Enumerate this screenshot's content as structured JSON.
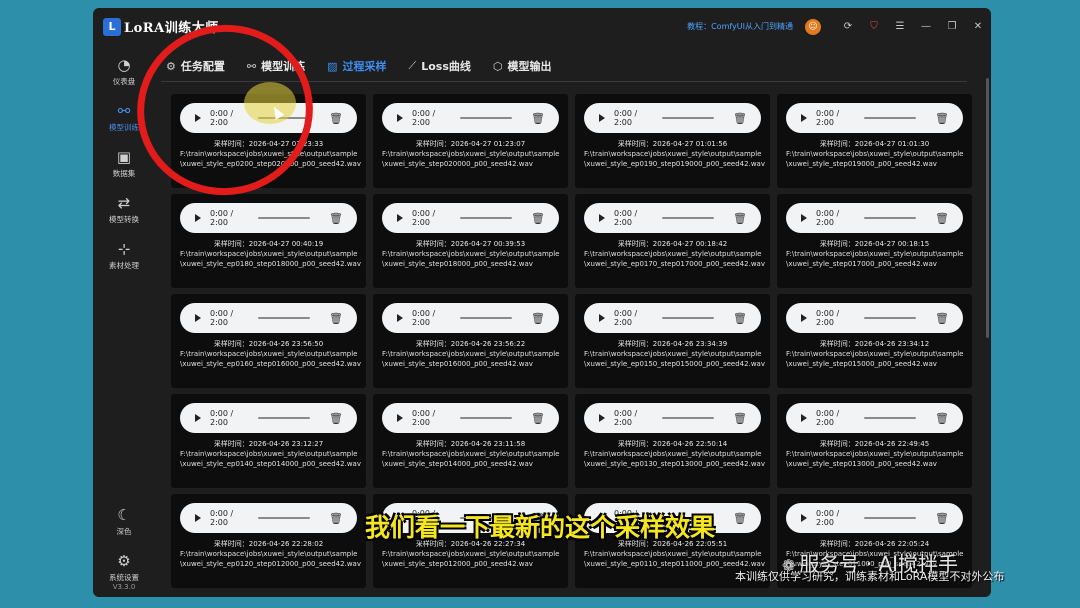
{
  "app": {
    "logo_glyph": "L",
    "title": "LoRA训练大师",
    "tutorial_link": "教程：ComfyUI从入门到精通",
    "avatar_glyph": "☺",
    "icons": [
      "refresh-icon",
      "shield-icon",
      "menu-icon",
      "minimize-icon",
      "maximize-icon",
      "close-icon"
    ],
    "accent_color": "#3d8ef0"
  },
  "sidebar": {
    "items": [
      {
        "label": "仪表盘",
        "icon": "dashboard-icon",
        "glyph": "◔"
      },
      {
        "label": "模型训练",
        "icon": "nodes-icon",
        "glyph": "⚯"
      },
      {
        "label": "数据集",
        "icon": "image-icon",
        "glyph": "▣"
      },
      {
        "label": "模型转换",
        "icon": "convert-icon",
        "glyph": "⇄"
      },
      {
        "label": "素材处理",
        "icon": "crop-icon",
        "glyph": "⊹"
      }
    ],
    "theme": {
      "label": "深色",
      "glyph": "☾"
    },
    "settings": {
      "label": "系统设置",
      "glyph": "⚙"
    },
    "version": "V3.3.0"
  },
  "tabs": [
    {
      "label": "任务配置",
      "glyph": "⚙"
    },
    {
      "label": "模型训练",
      "glyph": "⚯"
    },
    {
      "label": "过程采样",
      "glyph": "▨"
    },
    {
      "label": "Loss曲线",
      "glyph": "⟋"
    },
    {
      "label": "模型输出",
      "glyph": "⬡"
    }
  ],
  "samples": [
    {
      "time_label": "0:00 / 2:00",
      "sampled_at": "采样时间：2026-04-27 01:23:33",
      "path": "F:\\train\\workspace\\jobs\\xuwei_style\\output\\sample\\xuwei_style_ep0200_step020000_p00_seed42.wav"
    },
    {
      "time_label": "0:00 / 2:00",
      "sampled_at": "采样时间：2026-04-27 01:23:07",
      "path": "F:\\train\\workspace\\jobs\\xuwei_style\\output\\sample\\xuwei_style_step020000_p00_seed42.wav"
    },
    {
      "time_label": "0:00 / 2:00",
      "sampled_at": "采样时间：2026-04-27 01:01:56",
      "path": "F:\\train\\workspace\\jobs\\xuwei_style\\output\\sample\\xuwei_style_ep0190_step019000_p00_seed42.wav"
    },
    {
      "time_label": "0:00 / 2:00",
      "sampled_at": "采样时间：2026-04-27 01:01:30",
      "path": "F:\\train\\workspace\\jobs\\xuwei_style\\output\\sample\\xuwei_style_step019000_p00_seed42.wav"
    },
    {
      "time_label": "0:00 / 2:00",
      "sampled_at": "采样时间：2026-04-27 00:40:19",
      "path": "F:\\train\\workspace\\jobs\\xuwei_style\\output\\sample\\xuwei_style_ep0180_step018000_p00_seed42.wav"
    },
    {
      "time_label": "0:00 / 2:00",
      "sampled_at": "采样时间：2026-04-27 00:39:53",
      "path": "F:\\train\\workspace\\jobs\\xuwei_style\\output\\sample\\xuwei_style_step018000_p00_seed42.wav"
    },
    {
      "time_label": "0:00 / 2:00",
      "sampled_at": "采样时间：2026-04-27 00:18:42",
      "path": "F:\\train\\workspace\\jobs\\xuwei_style\\output\\sample\\xuwei_style_ep0170_step017000_p00_seed42.wav"
    },
    {
      "time_label": "0:00 / 2:00",
      "sampled_at": "采样时间：2026-04-27 00:18:15",
      "path": "F:\\train\\workspace\\jobs\\xuwei_style\\output\\sample\\xuwei_style_step017000_p00_seed42.wav"
    },
    {
      "time_label": "0:00 / 2:00",
      "sampled_at": "采样时间：2026-04-26 23:56:50",
      "path": "F:\\train\\workspace\\jobs\\xuwei_style\\output\\sample\\xuwei_style_ep0160_step016000_p00_seed42.wav"
    },
    {
      "time_label": "0:00 / 2:00",
      "sampled_at": "采样时间：2026-04-26 23:56:22",
      "path": "F:\\train\\workspace\\jobs\\xuwei_style\\output\\sample\\xuwei_style_step016000_p00_seed42.wav"
    },
    {
      "time_label": "0:00 / 2:00",
      "sampled_at": "采样时间：2026-04-26 23:34:39",
      "path": "F:\\train\\workspace\\jobs\\xuwei_style\\output\\sample\\xuwei_style_ep0150_step015000_p00_seed42.wav"
    },
    {
      "time_label": "0:00 / 2:00",
      "sampled_at": "采样时间：2026-04-26 23:34:12",
      "path": "F:\\train\\workspace\\jobs\\xuwei_style\\output\\sample\\xuwei_style_step015000_p00_seed42.wav"
    },
    {
      "time_label": "0:00 / 2:00",
      "sampled_at": "采样时间：2026-04-26 23:12:27",
      "path": "F:\\train\\workspace\\jobs\\xuwei_style\\output\\sample\\xuwei_style_ep0140_step014000_p00_seed42.wav"
    },
    {
      "time_label": "0:00 / 2:00",
      "sampled_at": "采样时间：2026-04-26 23:11:58",
      "path": "F:\\train\\workspace\\jobs\\xuwei_style\\output\\sample\\xuwei_style_step014000_p00_seed42.wav"
    },
    {
      "time_label": "0:00 / 2:00",
      "sampled_at": "采样时间：2026-04-26 22:50:14",
      "path": "F:\\train\\workspace\\jobs\\xuwei_style\\output\\sample\\xuwei_style_ep0130_step013000_p00_seed42.wav"
    },
    {
      "time_label": "0:00 / 2:00",
      "sampled_at": "采样时间：2026-04-26 22:49:45",
      "path": "F:\\train\\workspace\\jobs\\xuwei_style\\output\\sample\\xuwei_style_step013000_p00_seed42.wav"
    },
    {
      "time_label": "0:00 / 2:00",
      "sampled_at": "采样时间：2026-04-26 22:28:02",
      "path": "F:\\train\\workspace\\jobs\\xuwei_style\\output\\sample\\xuwei_style_ep0120_step012000_p00_seed42.wav"
    },
    {
      "time_label": "0:00 / 2:00",
      "sampled_at": "采样时间：2026-04-26 22:27:34",
      "path": "F:\\train\\workspace\\jobs\\xuwei_style\\output\\sample\\xuwei_style_step012000_p00_seed42.wav"
    },
    {
      "time_label": "0:00 / 2:00",
      "sampled_at": "采样时间：2026-04-26 22:05:51",
      "path": "F:\\train\\workspace\\jobs\\xuwei_style\\output\\sample\\xuwei_style_ep0110_step011000_p00_seed42.wav"
    },
    {
      "time_label": "0:00 / 2:00",
      "sampled_at": "采样时间：2026-04-26 22:05:24",
      "path": "F:\\train\\workspace\\jobs\\xuwei_style\\output\\sample\\xuwei_style_step011000_p00_seed42.wav"
    }
  ],
  "overlay": {
    "subtitle": "我们看一下最新的这个采样效果",
    "watermark": "服务号 · AI搅拌手",
    "watermark_icon": "wechat-icon",
    "footer_note": "本训练仅供学习研究，训练素材和LoRA模型不对外公布",
    "annotation_color": "#e21b1b",
    "subtitle_color": "#f5e61f"
  }
}
